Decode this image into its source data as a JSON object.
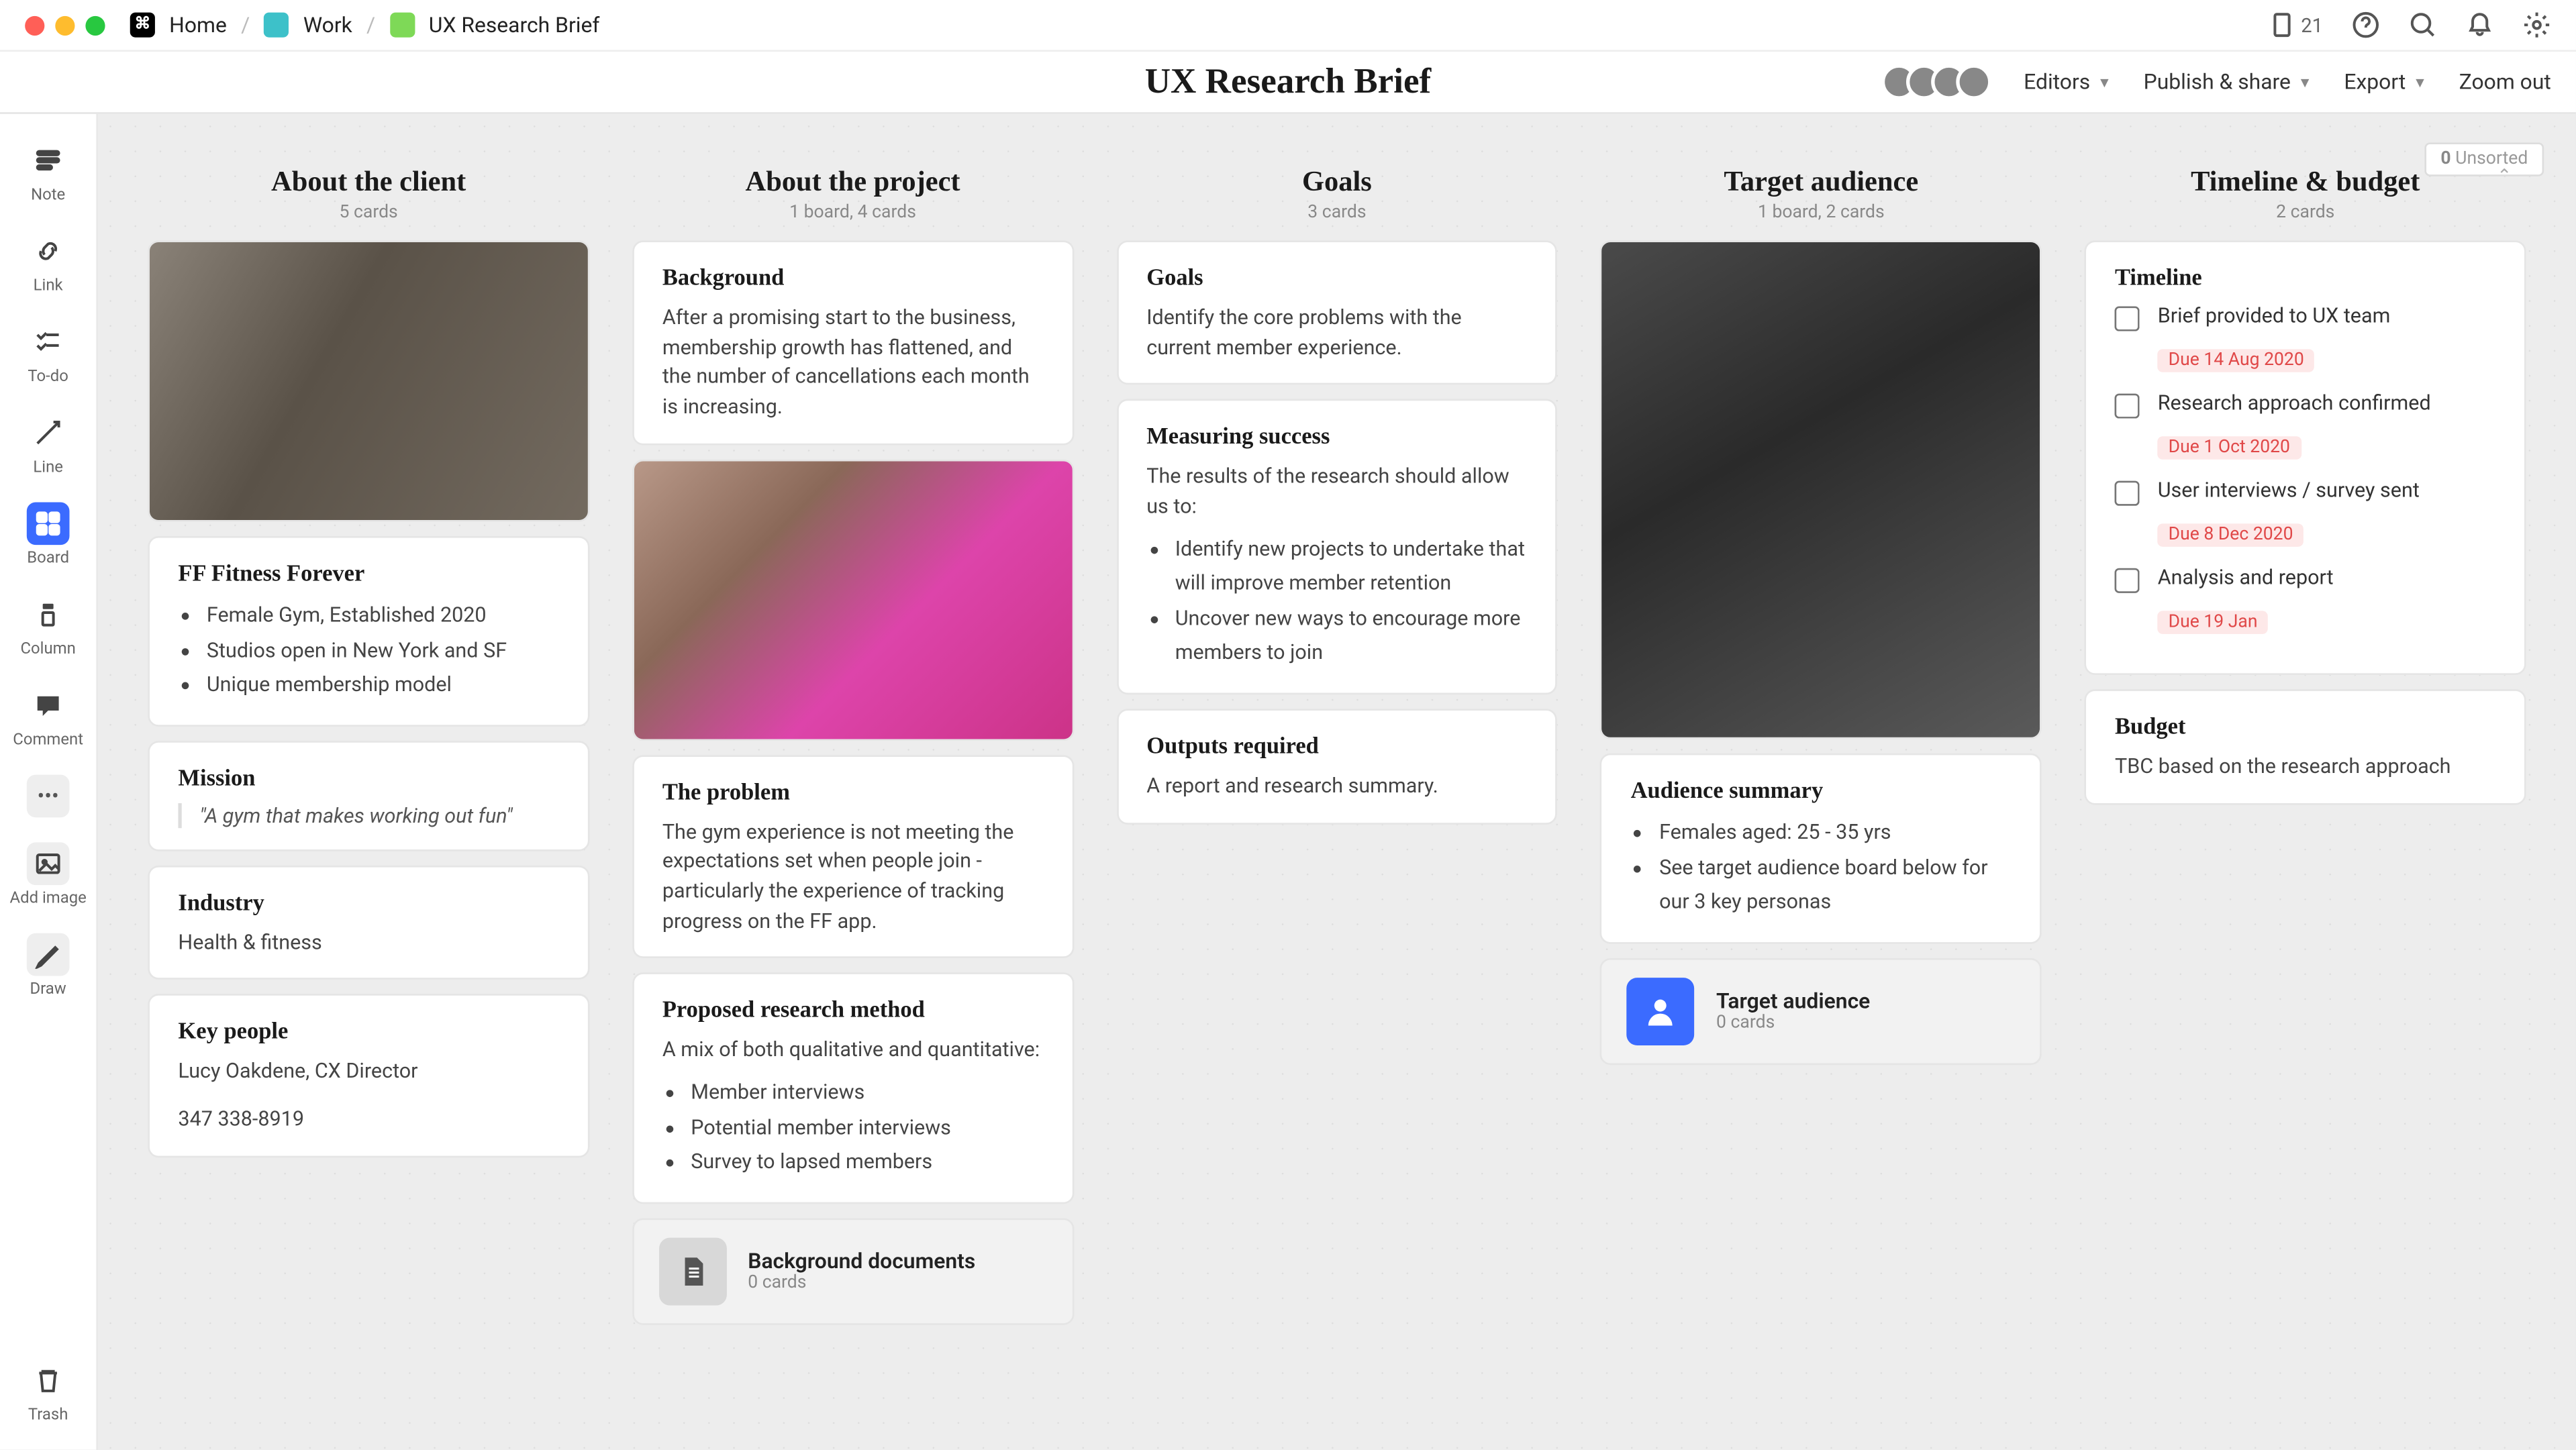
{
  "breadcrumbs": {
    "home": "Home",
    "work": "Work",
    "page": "UX Research Brief"
  },
  "topright": {
    "count": "21"
  },
  "title": "UX Research Brief",
  "header_menu": {
    "editors": "Editors",
    "publish": "Publish & share",
    "export": "Export",
    "zoom": "Zoom out"
  },
  "sidebar": [
    {
      "label": "Note"
    },
    {
      "label": "Link"
    },
    {
      "label": "To-do"
    },
    {
      "label": "Line"
    },
    {
      "label": "Board"
    },
    {
      "label": "Column"
    },
    {
      "label": "Comment"
    },
    {
      "label": "•••"
    },
    {
      "label": "Add image"
    },
    {
      "label": "Draw"
    }
  ],
  "trash": "Trash",
  "unsorted": {
    "n": "0",
    "label": "Unsorted"
  },
  "columns": [
    {
      "title": "About the client",
      "sub": "5 cards",
      "cards": [
        {
          "type": "image"
        },
        {
          "type": "list",
          "h": "FF Fitness Forever",
          "items": [
            "Female Gym, Established 2020",
            "Studios open in New York and SF",
            "Unique membership model"
          ]
        },
        {
          "type": "quote",
          "h": "Mission",
          "q": "\"A gym that makes working out fun\""
        },
        {
          "type": "text",
          "h": "Industry",
          "p": "Health & fitness"
        },
        {
          "type": "text2",
          "h": "Key people",
          "p": "Lucy Oakdene, CX Director",
          "p2": "347 338-8919"
        }
      ]
    },
    {
      "title": "About the project",
      "sub": "1 board, 4 cards",
      "cards": [
        {
          "type": "text",
          "h": "Background",
          "p": "After a promising start to the business, membership growth has flattened, and the number of cancellations each month is increasing."
        },
        {
          "type": "image"
        },
        {
          "type": "text",
          "h": "The problem",
          "p": "The gym experience is not meeting the expectations set when people join - particularly the experience of tracking progress on the FF app."
        },
        {
          "type": "textlist",
          "h": "Proposed research method",
          "p": "A mix of both qualitative and quantitative:",
          "items": [
            "Member interviews",
            "Potential member interviews",
            "Survey to lapsed members"
          ]
        },
        {
          "type": "subboard",
          "title": "Background documents",
          "sub": "0 cards"
        }
      ]
    },
    {
      "title": "Goals",
      "sub": "3 cards",
      "cards": [
        {
          "type": "text",
          "h": "Goals",
          "p": "Identify the core problems with the current member experience."
        },
        {
          "type": "textlist",
          "h": "Measuring success",
          "p": "The results of the research should allow us to:",
          "items": [
            "Identify new projects to undertake that will improve member retention",
            "Uncover new ways to encourage more members to join"
          ]
        },
        {
          "type": "text",
          "h": "Outputs required",
          "p": "A report and research summary."
        }
      ]
    },
    {
      "title": "Target audience",
      "sub": "1 board, 2 cards",
      "cards": [
        {
          "type": "image",
          "tall": true
        },
        {
          "type": "list",
          "h": "Audience summary",
          "items": [
            "Females aged: 25 - 35 yrs",
            "See target audience board below for our 3 key personas"
          ]
        },
        {
          "type": "subboard",
          "blue": true,
          "title": "Target audience",
          "sub": "0 cards"
        }
      ]
    },
    {
      "title": "Timeline & budget",
      "sub": "2 cards",
      "cards": [
        {
          "type": "timeline",
          "h": "Timeline",
          "items": [
            {
              "t": "Brief provided to UX team",
              "due": "Due 14 Aug 2020"
            },
            {
              "t": "Research approach confirmed",
              "due": "Due 1 Oct 2020"
            },
            {
              "t": "User interviews / survey sent",
              "due": "Due 8 Dec 2020"
            },
            {
              "t": "Analysis and report",
              "due": "Due 19 Jan"
            }
          ]
        },
        {
          "type": "text",
          "h": "Budget",
          "p": "TBC based on the research approach"
        }
      ]
    }
  ]
}
